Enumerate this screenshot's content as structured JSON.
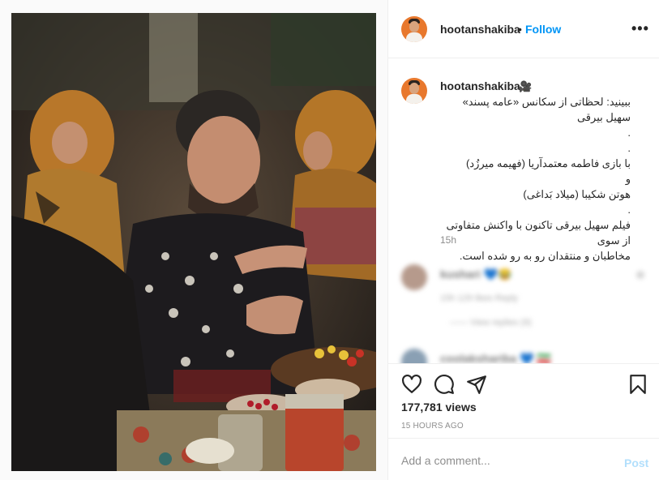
{
  "post": {
    "username": "hootanshakiba",
    "follow_label": "Follow",
    "separator": "•",
    "more_label": "•••",
    "camera_emoji": "🎥",
    "caption_lines": [
      "ببینید: لحظاتی از سکانس «عامه پسند» سهیل بیرقی",
      ".",
      ".",
      "با بازی فاطمه معتمدآریا (فهیمه میرزُد)",
      "و",
      "هوتن شکیبا (میلاد بَداغی)",
      ".",
      "فیلم سهیل بیرقی تاکنون با واکنش متفاوتی از سوی",
      "مخاطبان و منتقدان رو به رو شده است."
    ],
    "caption_time": "15h",
    "views": "177,781 views",
    "time_ago": "15 HOURS AGO"
  },
  "comments": [
    {
      "name": "kushari 💙😂",
      "meta": "15h   129 likes   Reply",
      "replies": "——  View replies (9)"
    },
    {
      "name": "coolakshariba 💙 🇮🇷",
      "meta": "",
      "replies": ""
    }
  ],
  "add_comment": {
    "placeholder": "Add a comment...",
    "post_label": "Post"
  },
  "colors": {
    "follow": "#0095f6",
    "post_disabled": "#b2dffc",
    "avatar_bg": "#e8782d"
  },
  "icons": [
    "heart-icon",
    "comment-icon",
    "share-icon",
    "bookmark-icon",
    "camera-icon",
    "more-icon"
  ]
}
